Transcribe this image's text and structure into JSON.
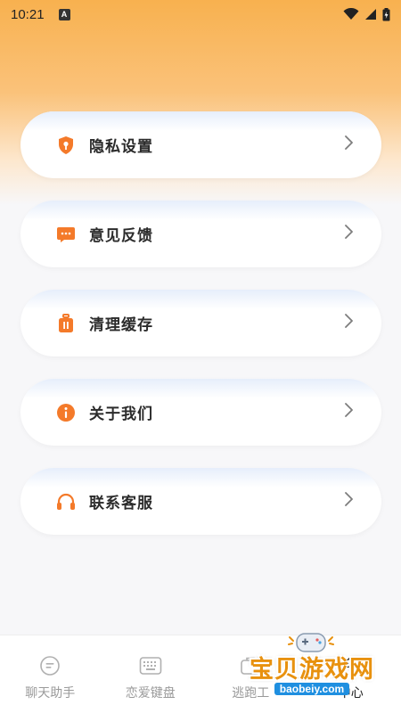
{
  "status_bar": {
    "time": "10:21",
    "notification_letter": "A"
  },
  "menu": [
    {
      "label": "隐私设置",
      "icon": "shield-lock-icon"
    },
    {
      "label": "意见反馈",
      "icon": "chat-dots-icon"
    },
    {
      "label": "清理缓存",
      "icon": "trash-icon"
    },
    {
      "label": "关于我们",
      "icon": "info-icon"
    },
    {
      "label": "联系客服",
      "icon": "headset-icon"
    }
  ],
  "tabbar": [
    {
      "label": "聊天助手",
      "icon": "chat-icon"
    },
    {
      "label": "恋爱键盘",
      "icon": "keyboard-icon"
    },
    {
      "label": "逃跑工",
      "icon": "toolbox-icon"
    },
    {
      "label": "中心",
      "icon": "user-center-icon"
    }
  ],
  "watermark": {
    "title": "宝贝游戏网",
    "url": "baobeiy.com"
  },
  "colors": {
    "accent": "#f47a2a",
    "gradient_top": "#f8b14f",
    "background": "#f7f7f9"
  }
}
